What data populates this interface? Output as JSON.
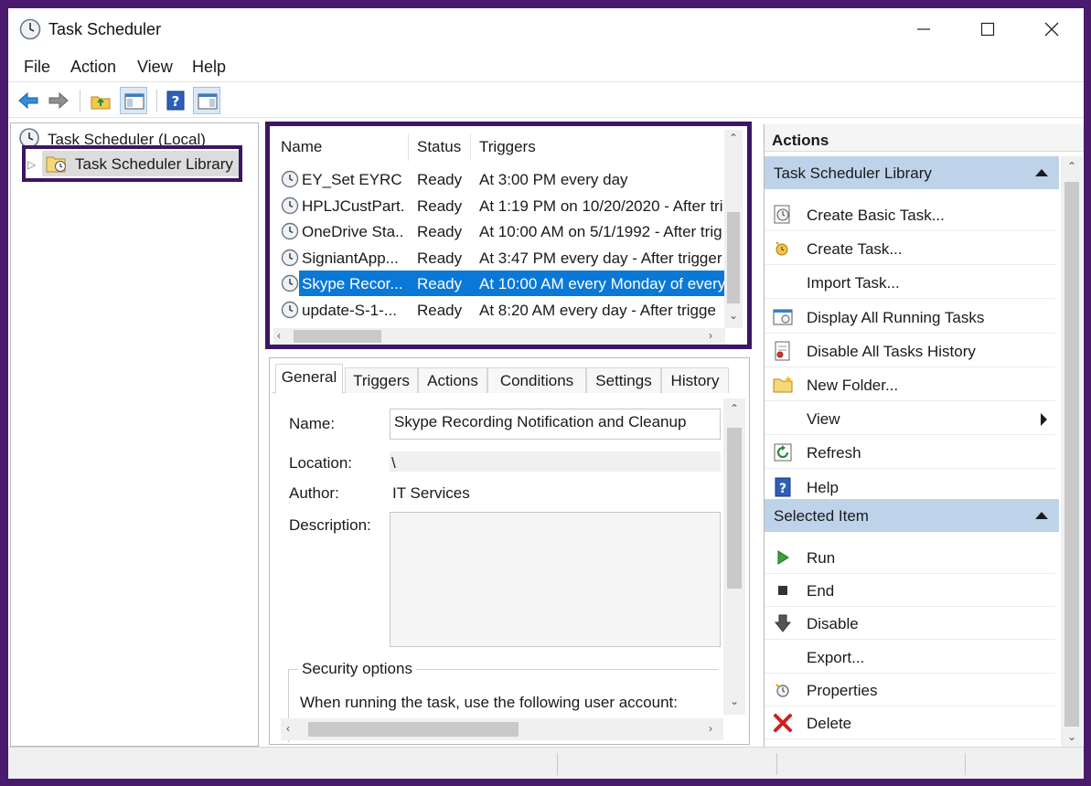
{
  "window": {
    "title": "Task Scheduler"
  },
  "menu": {
    "file": "File",
    "action": "Action",
    "view": "View",
    "help": "Help"
  },
  "tree": {
    "root": "Task Scheduler (Local)",
    "library": "Task Scheduler Library"
  },
  "tasklist": {
    "columns": [
      "Name",
      "Status",
      "Triggers"
    ],
    "rows": [
      {
        "name": "EY_Set EYRC ...",
        "status": "Ready",
        "trigger": "At 3:00 PM every day"
      },
      {
        "name": "HPLJCustPart...",
        "status": "Ready",
        "trigger": "At 1:19 PM on 10/20/2020 - After tri"
      },
      {
        "name": "OneDrive Sta...",
        "status": "Ready",
        "trigger": "At 10:00 AM on 5/1/1992 - After trig"
      },
      {
        "name": "SigniantApp...",
        "status": "Ready",
        "trigger": "At 3:47 PM every day - After trigger"
      },
      {
        "name": "Skype Recor...",
        "status": "Ready",
        "trigger": "At 10:00 AM every Monday of every"
      },
      {
        "name": "update-S-1-...",
        "status": "Ready",
        "trigger": "At 8:20 AM every day - After trigge"
      }
    ],
    "selected_index": 4
  },
  "details": {
    "tabs": [
      "General",
      "Triggers",
      "Actions",
      "Conditions",
      "Settings",
      "History"
    ],
    "active_tab": "General",
    "name_label": "Name:",
    "name_value": "Skype Recording Notification and Cleanup",
    "location_label": "Location:",
    "location_value": "\\",
    "author_label": "Author:",
    "author_value": "IT Services",
    "description_label": "Description:",
    "description_value": "",
    "security_legend": "Security options",
    "security_text": "When running the task, use the following user account:"
  },
  "actions_pane": {
    "title": "Actions",
    "library_header": "Task Scheduler Library",
    "library_items": [
      {
        "label": "Create Basic Task...",
        "icon": "create-basic-task-icon"
      },
      {
        "label": "Create Task...",
        "icon": "create-task-icon"
      },
      {
        "label": "Import Task...",
        "icon": ""
      },
      {
        "label": "Display All Running Tasks",
        "icon": "running-tasks-icon"
      },
      {
        "label": "Disable All Tasks History",
        "icon": "tasks-history-icon"
      },
      {
        "label": "New Folder...",
        "icon": "folder-icon"
      },
      {
        "label": "View",
        "icon": ""
      },
      {
        "label": "Refresh",
        "icon": "refresh-icon"
      },
      {
        "label": "Help",
        "icon": "help-icon"
      }
    ],
    "selected_header": "Selected Item",
    "selected_items": [
      {
        "label": "Run",
        "icon": "run-icon"
      },
      {
        "label": "End",
        "icon": "end-icon"
      },
      {
        "label": "Disable",
        "icon": "disable-icon"
      },
      {
        "label": "Export...",
        "icon": ""
      },
      {
        "label": "Properties",
        "icon": "properties-icon"
      },
      {
        "label": "Delete",
        "icon": "delete-icon"
      }
    ]
  },
  "colors": {
    "selection": "#0a78d7",
    "section_header": "#bed3ea",
    "highlight_border": "#3d1565"
  }
}
